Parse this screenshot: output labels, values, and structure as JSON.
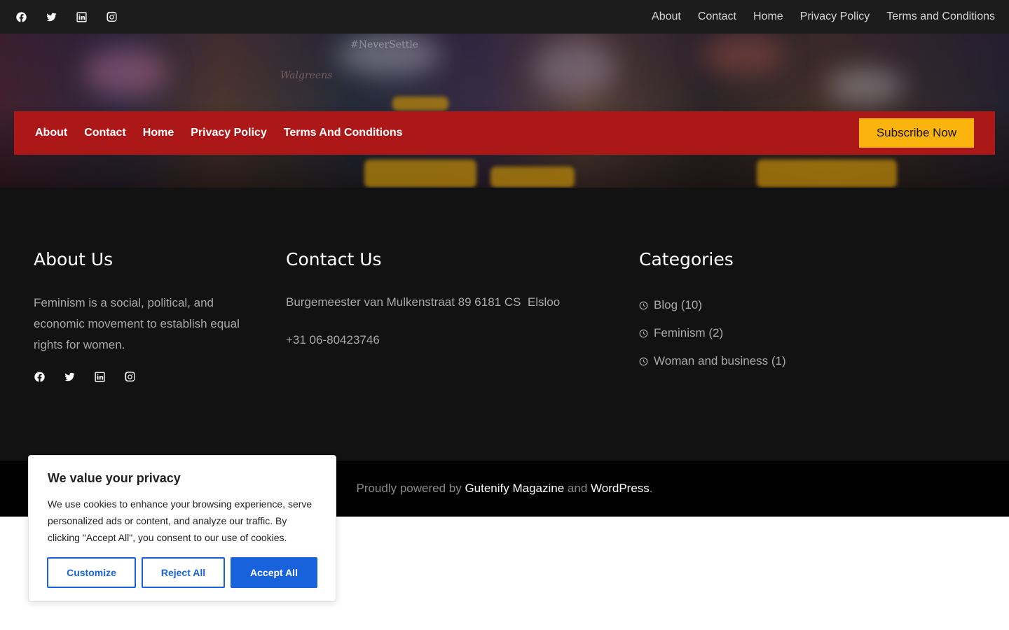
{
  "topbar": {
    "social_icons": [
      "facebook-icon",
      "twitter-icon",
      "linkedin-icon",
      "instagram-icon"
    ],
    "nav": [
      "About",
      "Contact",
      "Home",
      "Privacy Policy",
      "Terms and Conditions"
    ]
  },
  "hero": {
    "sign_text": "#NeverSettle",
    "store_sign": "Walgreens"
  },
  "mainnav": {
    "items": [
      "About",
      "Contact",
      "Home",
      "Privacy Policy",
      "Terms And Conditions"
    ],
    "subscribe_label": "Subscribe Now"
  },
  "widgets": {
    "about": {
      "title": "About Us",
      "text": "Feminism is a social, political, and economic movement to establish equal rights for women."
    },
    "contact": {
      "title": "Contact Us",
      "address": "Burgemeester van Mulkenstraat 89 6181 CS  Elsloo",
      "phone": "+31 06-80423746"
    },
    "categories": {
      "title": "Categories",
      "items": [
        "Blog (10)",
        "Feminism (2)",
        "Woman and business (1)"
      ]
    }
  },
  "footer": {
    "prefix": "Proudly powered by ",
    "theme_link": "Gutenify Magazine",
    "middle": " and ",
    "wp_link": "WordPress",
    "suffix": "."
  },
  "cookie": {
    "title": "We value your privacy",
    "text": "We use cookies to enhance your browsing experience, serve personalized ads or content, and analyze our traffic. By clicking \"Accept All\", you consent to our use of cookies.",
    "customize": "Customize",
    "reject": "Reject All",
    "accept": "Accept All"
  },
  "colors": {
    "accent_red": "#ac1717",
    "subscribe_yellow": "#fbb30d",
    "cookie_blue": "#1863dc"
  }
}
